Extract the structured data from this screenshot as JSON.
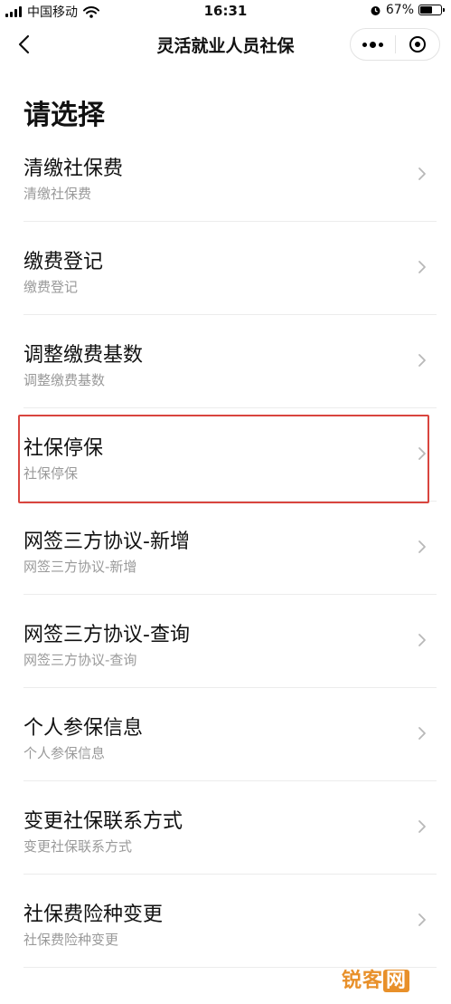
{
  "status_bar": {
    "carrier": "中国移动",
    "time": "16:31",
    "battery": "67%",
    "battery_level": 0.67
  },
  "nav": {
    "title": "灵活就业人员社保"
  },
  "page": {
    "heading": "请选择"
  },
  "menu": [
    {
      "title": "清缴社保费",
      "subtitle": "清缴社保费"
    },
    {
      "title": "缴费登记",
      "subtitle": "缴费登记"
    },
    {
      "title": "调整缴费基数",
      "subtitle": "调整缴费基数"
    },
    {
      "title": "社保停保",
      "subtitle": "社保停保",
      "highlighted": true
    },
    {
      "title": "网签三方协议-新增",
      "subtitle": "网签三方协议-新增"
    },
    {
      "title": "网签三方协议-查询",
      "subtitle": "网签三方协议-查询"
    },
    {
      "title": "个人参保信息",
      "subtitle": "个人参保信息"
    },
    {
      "title": "变更社保联系方式",
      "subtitle": "变更社保联系方式"
    },
    {
      "title": "社保费险种变更",
      "subtitle": "社保费险种变更"
    }
  ],
  "watermark": {
    "text_a": "锐客",
    "text_b": "网"
  },
  "colors": {
    "highlight_border": "#d9453e",
    "subtitle": "#9a9a9a",
    "watermark": "#e8902a"
  }
}
